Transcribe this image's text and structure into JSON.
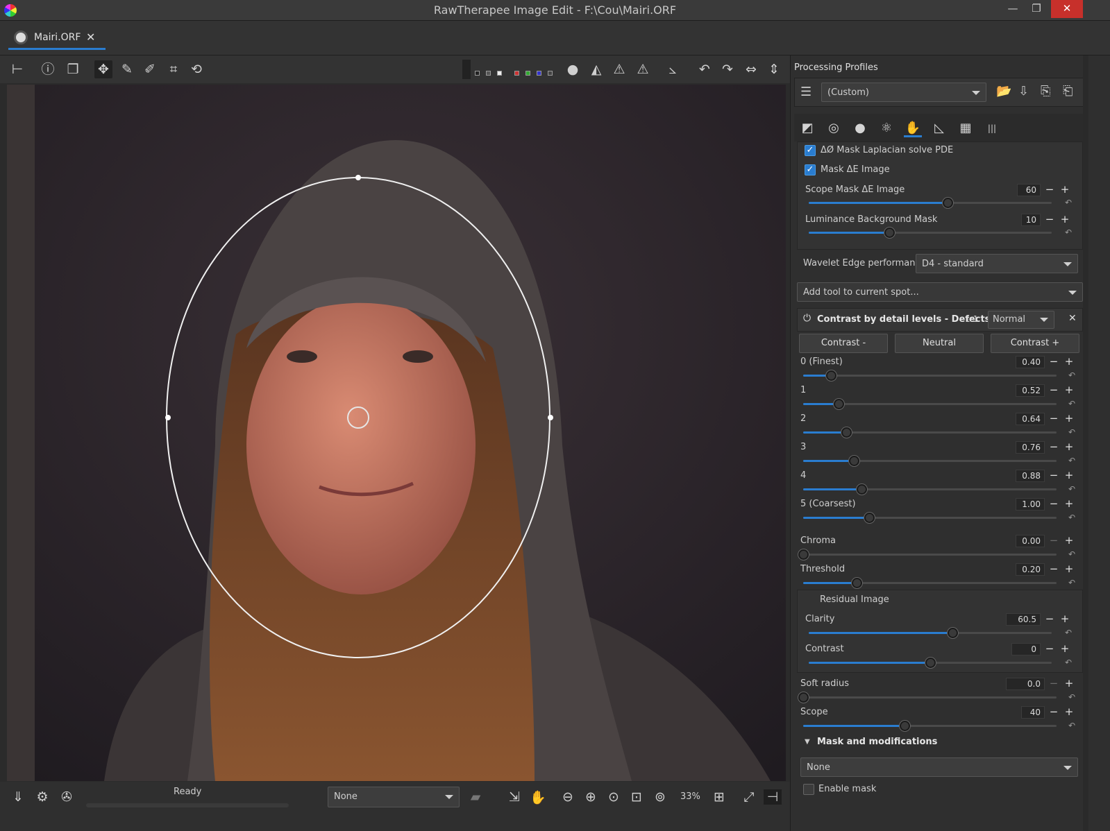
{
  "window": {
    "title": "RawTherapee Image Edit - F:\\Cou\\Mairi.ORF",
    "minimize": "—",
    "maximize": "❐",
    "close": "✕"
  },
  "tab": {
    "label": "Mairi.ORF",
    "close": "✕"
  },
  "status": {
    "ready": "Ready"
  },
  "bottom": {
    "preview_select": "None",
    "zoom": "33%"
  },
  "processing": {
    "title": "Processing Profiles",
    "profile": "(Custom)"
  },
  "mask_options": {
    "laplacian": "ΔØ Mask Laplacian solve PDE",
    "mask_de_image": "Mask ΔE Image",
    "scope_label": "Scope Mask ΔE Image",
    "scope_value": "60",
    "scope_fraction": 0.57,
    "lum_label": "Luminance Background Mask",
    "lum_value": "10",
    "lum_fraction": 0.33
  },
  "wavelet": {
    "label": "Wavelet Edge performance:",
    "value": "D4 - standard"
  },
  "add_tool": "Add tool to current spot...",
  "cbdl": {
    "title": "Contrast by detail levels - Defects",
    "ratio": "1:1",
    "mode": "Normal",
    "contrast_minus": "Contrast -",
    "neutral": "Neutral",
    "contrast_plus": "Contrast +",
    "levels": [
      {
        "label": "0 (Finest)",
        "value": "0.40",
        "fraction": 0.11
      },
      {
        "label": "1",
        "value": "0.52",
        "fraction": 0.14
      },
      {
        "label": "2",
        "value": "0.64",
        "fraction": 0.17
      },
      {
        "label": "3",
        "value": "0.76",
        "fraction": 0.2
      },
      {
        "label": "4",
        "value": "0.88",
        "fraction": 0.23
      },
      {
        "label": "5 (Coarsest)",
        "value": "1.00",
        "fraction": 0.26
      }
    ],
    "chroma_label": "Chroma",
    "chroma_value": "0.00",
    "chroma_fraction": 0.0,
    "threshold_label": "Threshold",
    "threshold_value": "0.20",
    "threshold_fraction": 0.21,
    "residual_label": "Residual Image",
    "clarity_label": "Clarity",
    "clarity_value": "60.5",
    "clarity_fraction": 0.59,
    "contrast_label": "Contrast",
    "contrast_value": "0",
    "contrast_fraction": 0.5,
    "soft_label": "Soft radius",
    "soft_value": "0.0",
    "soft_fraction": 0.0,
    "scope_label": "Scope",
    "scope_value": "40",
    "scope_fraction": 0.4
  },
  "mask_mod": {
    "title": "Mask and modifications",
    "select": "None",
    "enable": "Enable mask"
  },
  "colors": {
    "accent": "#2a7dd0",
    "close_red": "#c7302b"
  }
}
